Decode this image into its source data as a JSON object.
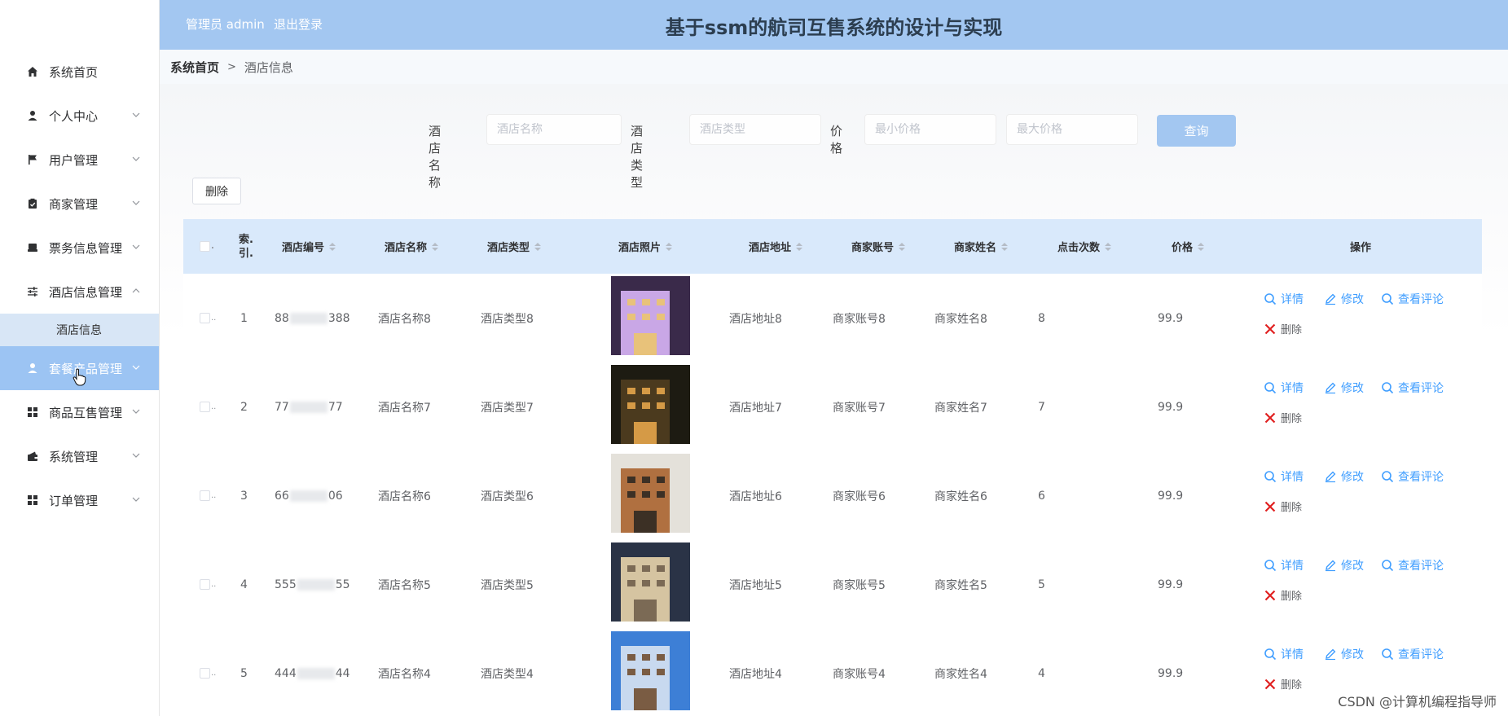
{
  "header": {
    "admin_label": "管理员 admin",
    "logout_label": "退出登录",
    "title": "基于ssm的航司互售系统的设计与实现"
  },
  "sidebar": {
    "items": [
      {
        "label": "系统首页",
        "icon": "home-icon",
        "chevron": false
      },
      {
        "label": "个人中心",
        "icon": "user-icon",
        "chevron": true
      },
      {
        "label": "用户管理",
        "icon": "flag-icon",
        "chevron": true
      },
      {
        "label": "商家管理",
        "icon": "clipboard-icon",
        "chevron": true
      },
      {
        "label": "票务信息管理",
        "icon": "ticket-icon",
        "chevron": true
      },
      {
        "label": "酒店信息管理",
        "icon": "sliders-icon",
        "chevron": true,
        "expanded": true
      },
      {
        "label": "套餐产品管理",
        "icon": "user-icon",
        "chevron": true,
        "active": true
      },
      {
        "label": "商品互售管理",
        "icon": "grid-icon",
        "chevron": true
      },
      {
        "label": "系统管理",
        "icon": "wallet-icon",
        "chevron": true
      },
      {
        "label": "订单管理",
        "icon": "grid-icon",
        "chevron": true
      }
    ],
    "submenu": [
      {
        "label": "酒店信息"
      }
    ]
  },
  "breadcrumb": {
    "home": "系统首页",
    "separator": ">",
    "current": "酒店信息"
  },
  "search": {
    "name_label": "酒店名称",
    "name_placeholder": "酒店名称",
    "type_label": "酒店类型",
    "type_placeholder": "酒店类型",
    "price_label": "价格",
    "min_price_placeholder": "最小价格",
    "max_price_placeholder": "最大价格",
    "query_button": "查询"
  },
  "toolbar": {
    "delete_button": "删除"
  },
  "table": {
    "headers": {
      "index": "索引",
      "index_line1": "索.",
      "index_line2": "引.",
      "hotel_no": "酒店编号",
      "hotel_name": "酒店名称",
      "hotel_type": "酒店类型",
      "hotel_photo": "酒店照片",
      "hotel_address": "酒店地址",
      "merchant_account": "商家账号",
      "merchant_name": "商家姓名",
      "clicks": "点击次数",
      "price": "价格",
      "actions": "操作"
    },
    "actions": {
      "detail": "详情",
      "edit": "修改",
      "view_comments": "查看评论",
      "delete": "删除"
    },
    "rows": [
      {
        "index": "1",
        "hotel_no_start": "88",
        "hotel_no_end": "388",
        "hotel_name": "酒店名称8",
        "hotel_type": "酒店类型8",
        "photo_colors": [
          "#3a2a4a",
          "#c9a7e6",
          "#e8c27a"
        ],
        "hotel_address": "酒店地址8",
        "merchant_account": "商家账号8",
        "merchant_name": "商家姓名8",
        "clicks": "8",
        "price": "99.9"
      },
      {
        "index": "2",
        "hotel_no_start": "77",
        "hotel_no_end": "77",
        "hotel_name": "酒店名称7",
        "hotel_type": "酒店类型7",
        "photo_colors": [
          "#1d1b12",
          "#4b3a1e",
          "#d59a46"
        ],
        "hotel_address": "酒店地址7",
        "merchant_account": "商家账号7",
        "merchant_name": "商家姓名7",
        "clicks": "7",
        "price": "99.9"
      },
      {
        "index": "3",
        "hotel_no_start": "66",
        "hotel_no_end": "06",
        "hotel_name": "酒店名称6",
        "hotel_type": "酒店类型6",
        "photo_colors": [
          "#e4e1da",
          "#b07040",
          "#3c3025"
        ],
        "hotel_address": "酒店地址6",
        "merchant_account": "商家账号6",
        "merchant_name": "商家姓名6",
        "clicks": "6",
        "price": "99.9"
      },
      {
        "index": "4",
        "hotel_no_start": "555",
        "hotel_no_end": "55",
        "hotel_name": "酒店名称5",
        "hotel_type": "酒店类型5",
        "photo_colors": [
          "#2a3346",
          "#d5c4a1",
          "#7b6a55"
        ],
        "hotel_address": "酒店地址5",
        "merchant_account": "商家账号5",
        "merchant_name": "商家姓名5",
        "clicks": "5",
        "price": "99.9"
      },
      {
        "index": "5",
        "hotel_no_start": "444",
        "hotel_no_end": "44",
        "hotel_name": "酒店名称4",
        "hotel_type": "酒店类型4",
        "photo_colors": [
          "#3d7fd6",
          "#c8d9ef",
          "#7a5c43"
        ],
        "hotel_address": "酒店地址4",
        "merchant_account": "商家账号4",
        "merchant_name": "商家姓名4",
        "clicks": "4",
        "price": "99.9"
      }
    ]
  },
  "watermark": "CSDN @计算机编程指导师",
  "colors": {
    "header_bg": "#a3c7f1",
    "active_menu_bg": "#9cc4f3",
    "table_header_bg": "#d9e9fb",
    "link_blue": "#409eff",
    "danger_red": "#f56c6c"
  }
}
